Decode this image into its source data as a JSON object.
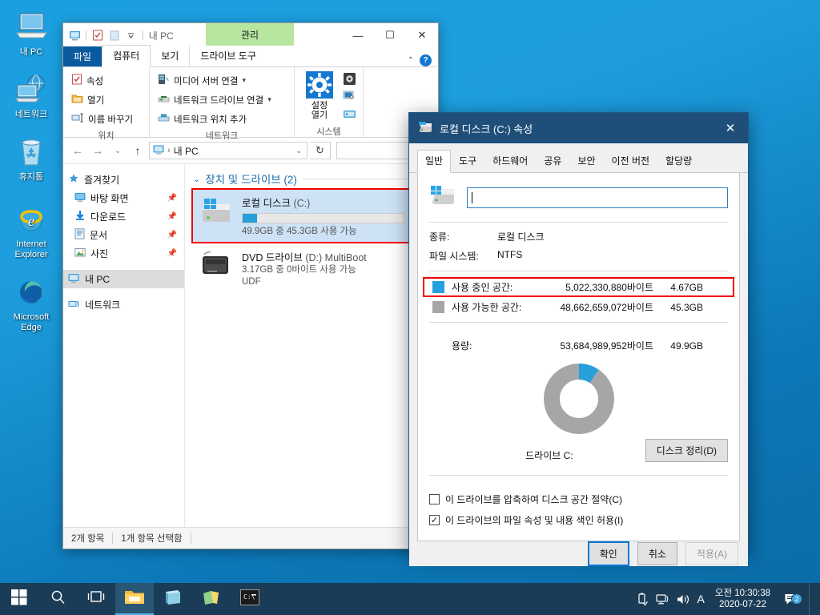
{
  "desktop": {
    "icons": [
      {
        "label": "내 PC",
        "icon": "computer-icon"
      },
      {
        "label": "네트워크",
        "icon": "network-icon"
      },
      {
        "label": "휴지통",
        "icon": "recycle-bin-icon"
      },
      {
        "label": "Internet\nExplorer",
        "icon": "internet-explorer-icon"
      },
      {
        "label": "Microsoft\nEdge",
        "icon": "microsoft-edge-icon"
      }
    ],
    "background_color": "#1a9fe0"
  },
  "explorer": {
    "title": "내 PC",
    "context_tab": "관리",
    "quick_access": [
      "computer-icon",
      "properties-icon",
      "new-folder-icon",
      "customize-chevron-icon"
    ],
    "window_buttons": {
      "minimize": "—",
      "maximize": "☐",
      "close": "✕"
    },
    "tabs": [
      {
        "label": "파일",
        "state": "file"
      },
      {
        "label": "컴퓨터",
        "state": "active"
      },
      {
        "label": "보기",
        "state": "normal"
      },
      {
        "label": "드라이브 도구",
        "state": "normal"
      }
    ],
    "ribbon": {
      "groups": [
        {
          "label": "위치",
          "items": [
            {
              "label": "속성",
              "icon": "properties-icon"
            },
            {
              "label": "열기",
              "icon": "open-folder-icon"
            },
            {
              "label": "이름 바꾸기",
              "icon": "rename-icon"
            }
          ]
        },
        {
          "label": "네트워크",
          "items": [
            {
              "label": "미디어 서버 연결",
              "icon": "media-server-icon",
              "dropdown": "▾"
            },
            {
              "label": "네트워크 드라이브 연결",
              "icon": "map-drive-icon",
              "dropdown": "▾"
            },
            {
              "label": "네트워크 위치 추가",
              "icon": "add-network-location-icon",
              "dropdown": ""
            }
          ]
        },
        {
          "label": "시스템",
          "big_button": {
            "label_line1": "설정",
            "label_line2": "열기",
            "icon": "settings-gear-icon"
          },
          "small_icons": [
            "uninstall-program-icon",
            "system-properties-icon",
            "manage-icon"
          ]
        }
      ]
    },
    "address_bar": {
      "back": "←",
      "forward": "→",
      "recent": "⌄",
      "up": "↑",
      "icon": "computer-icon",
      "separator": "›",
      "path": "내 PC",
      "dropdown": "⌄",
      "refresh": "↻",
      "search_value": "",
      "search_placeholder": ""
    },
    "nav_pane": [
      {
        "label": "즐겨찾기",
        "icon": "favorites-star-icon",
        "pinned": false,
        "selected": false,
        "root": true
      },
      {
        "label": "바탕 화면",
        "icon": "desktop-icon",
        "pinned": true,
        "selected": false,
        "root": false
      },
      {
        "label": "다운로드",
        "icon": "downloads-icon",
        "pinned": true,
        "selected": false,
        "root": false
      },
      {
        "label": "문서",
        "icon": "documents-icon",
        "pinned": true,
        "selected": false,
        "root": false
      },
      {
        "label": "사진",
        "icon": "pictures-icon",
        "pinned": true,
        "selected": false,
        "root": false
      },
      {
        "label": "내 PC",
        "icon": "computer-icon",
        "pinned": false,
        "selected": true,
        "root": true
      },
      {
        "label": "네트워크",
        "icon": "network-icon",
        "pinned": false,
        "selected": false,
        "root": true
      }
    ],
    "group_header": "장치 및 드라이브 (2)",
    "drives": [
      {
        "name": "로컬 디스크",
        "letter": "(C:)",
        "meta": "49.9GB 중 45.3GB 사용 가능",
        "extra": "",
        "used_percent": 9,
        "selected": true,
        "icon": "local-disk-icon"
      },
      {
        "name": "DVD 드라이브",
        "letter": "(D:) MultiBoot",
        "meta": "3.17GB 중 0바이트 사용 가능",
        "extra": "UDF",
        "used_percent": 0,
        "selected": false,
        "icon": "dvd-drive-icon"
      }
    ],
    "status": {
      "items_count": "2개 항목",
      "selected_count": "1개 항목 선택함"
    }
  },
  "properties_dialog": {
    "title": "로컬 디스크 (C:) 속성",
    "title_icon": "drive-icon",
    "close": "✕",
    "tabs": [
      {
        "label": "일반",
        "active": true
      },
      {
        "label": "도구",
        "active": false
      },
      {
        "label": "하드웨어",
        "active": false
      },
      {
        "label": "공유",
        "active": false
      },
      {
        "label": "보안",
        "active": false
      },
      {
        "label": "이전 버전",
        "active": false
      },
      {
        "label": "할당량",
        "active": false
      }
    ],
    "volume_label_value": "",
    "info": [
      {
        "key": "종류:",
        "value": "로컬 디스크"
      },
      {
        "key": "파일 시스템:",
        "value": "NTFS"
      }
    ],
    "space": {
      "used": {
        "label": "사용 중인 공간:",
        "bytes": "5,022,330,880바이트",
        "gb": "4.67GB",
        "color": "#26a0da",
        "highlighted": true
      },
      "free": {
        "label": "사용 가능한 공간:",
        "bytes": "48,662,659,072바이트",
        "gb": "45.3GB",
        "color": "#a6a6a6",
        "highlighted": false
      },
      "capacity": {
        "label": "용량:",
        "bytes": "53,684,989,952바이트",
        "gb": "49.9GB"
      }
    },
    "donut": {
      "used_percent": 9.4,
      "used_color": "#26a0da",
      "free_color": "#a6a6a6",
      "caption": "드라이브 C:"
    },
    "cleanup_button": "디스크 정리(D)",
    "checkboxes": [
      {
        "label": "이 드라이브를 압축하여 디스크 공간 절약(C)",
        "checked": false
      },
      {
        "label": "이 드라이브의 파일 속성 및 내용 색인 허용(I)",
        "checked": true
      }
    ],
    "buttons": [
      {
        "label": "확인",
        "state": "default"
      },
      {
        "label": "취소",
        "state": "normal"
      },
      {
        "label": "적용(A)",
        "state": "disabled"
      }
    ]
  },
  "taskbar": {
    "items": [
      {
        "icon": "start-windows-icon",
        "active": false
      },
      {
        "icon": "search-icon",
        "active": false
      },
      {
        "icon": "task-view-icon",
        "active": false
      },
      {
        "icon": "file-explorer-icon",
        "active": true
      },
      {
        "icon": "store-icon",
        "active": false
      },
      {
        "icon": "sticky-notes-icon",
        "active": false
      },
      {
        "icon": "command-prompt-icon",
        "active": false
      }
    ],
    "tray": {
      "icons": [
        "usb-eject-icon",
        "network-icon",
        "volume-icon",
        "ime-icon"
      ],
      "ime": "A",
      "time": "오전 10:30:38",
      "date": "2020-07-22",
      "notification_count": "2"
    }
  }
}
